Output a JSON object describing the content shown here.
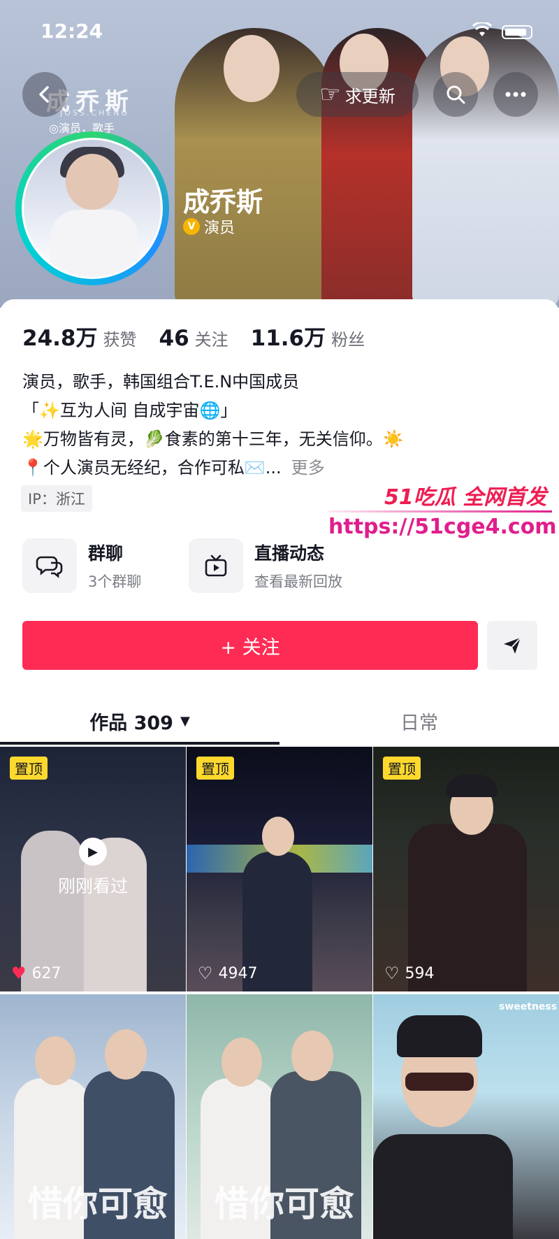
{
  "status_bar": {
    "time": "12:24"
  },
  "header": {
    "brand_text": "成乔斯",
    "brand_sub": "JOSS.CHENG",
    "brand_tag": "◎演员，歌手",
    "update_label": "求更新",
    "name": "成乔斯",
    "role": "演员",
    "verify_badge": "V"
  },
  "stats": [
    {
      "value": "24.8万",
      "label": "获赞"
    },
    {
      "value": "46",
      "label": "关注"
    },
    {
      "value": "11.6万",
      "label": "粉丝"
    }
  ],
  "bio": {
    "lines": [
      "演员，歌手，韩国组合T.E.N中国成员",
      "「✨互为人间 自成宇宙🌐」",
      "🌟万物皆有灵，🥬食素的第十三年，无关信仰。☀️",
      "📍个人演员无经纪，合作可私✉️..."
    ],
    "more": "更多"
  },
  "ip": "IP：浙江",
  "features": {
    "chat": {
      "title": "群聊",
      "sub": "3个群聊"
    },
    "live": {
      "title": "直播动态",
      "sub": "查看最新回放"
    }
  },
  "watermark": {
    "top": "51吃瓜 全网首发",
    "url": "https://51cge4.com"
  },
  "actions": {
    "follow": "+ 关注"
  },
  "tabs": {
    "works": "作品 309",
    "daily": "日常"
  },
  "videos": [
    {
      "pinned": "置顶",
      "likes": "627",
      "overlay": "刚刚看过"
    },
    {
      "pinned": "置顶",
      "likes": "4947"
    },
    {
      "pinned": "置顶",
      "likes": "594"
    },
    {
      "poster": "惜你可愈"
    },
    {
      "poster": "惜你可愈"
    },
    {
      "tag": "sweetness"
    }
  ],
  "colors": {
    "accent": "#fe2c55",
    "pin": "#fdd82d",
    "text": "#161823"
  },
  "icons": [
    "back-icon",
    "pointing-hand-icon",
    "search-icon",
    "more-icon",
    "chat-bubbles-icon",
    "tv-icon",
    "send-icon",
    "play-icon",
    "heart-icon",
    "caret-down-icon"
  ]
}
